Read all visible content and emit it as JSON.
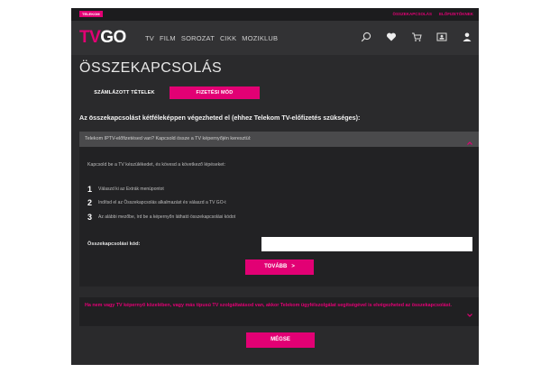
{
  "topbar": {
    "brand": "TELEKOM",
    "links": [
      "ÖSSZEKAPCSOLÁS",
      "ELŐFIZETŐKNEK"
    ]
  },
  "nav": {
    "logo_tv": "TV",
    "logo_go": "GO",
    "links": [
      "TV",
      "FILM",
      "SOROZAT",
      "CIKK",
      "MOZIKLUB"
    ],
    "icons": [
      "search-icon",
      "heart-icon",
      "cart-icon",
      "profile-card-icon",
      "user-icon"
    ]
  },
  "page": {
    "title": "ÖSSZEKAPCSOLÁS",
    "tabs": [
      {
        "label": "SZÁMLÁZOTT TÉTELEK",
        "active": false
      },
      {
        "label": "FIZETÉSI MÓD",
        "active": true
      }
    ],
    "lead": "Az összekapcsolást kétféleképpen végezheted el (ehhez Telekom TV-előfizetés szükséges):"
  },
  "panel": {
    "header": "Telekom IPTV-előfizetésed van? Kapcsold össze a TV képernyőjén keresztül:",
    "intro": "Kapcsold be a TV készülékedet, és kövesd a következő lépéseket:",
    "steps": [
      {
        "num": "1",
        "text": "Válaszd ki az Extrák menüpontot"
      },
      {
        "num": "2",
        "text": "Indítsd el az Összekapcsolás alkalmazást és válaszd a TV GO-t"
      },
      {
        "num": "3",
        "text": "Az alábbi mezőbe, írd be a képernyőn látható összekapcsolási kódot"
      }
    ],
    "code_label": "Összekapcsolási kód:",
    "code_value": "",
    "next_button": "TOVÁBB",
    "next_arrow": ">"
  },
  "notice": {
    "text": "Ha nem vagy TV képernyő közelében, vagy más típusú TV szolgáltatásod van, akkor Telekom ügyfélszolgálat segítségével is elvégezheted az összekapcsolást."
  },
  "cancel_button": "MÉGSE",
  "colors": {
    "accent": "#e20074",
    "background": "#2a2a2c"
  }
}
